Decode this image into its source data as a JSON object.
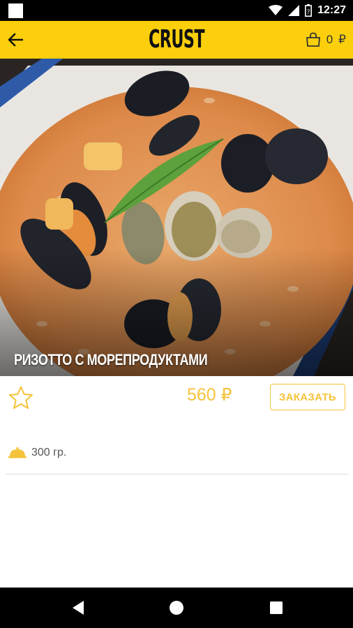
{
  "status_bar": {
    "time": "12:27"
  },
  "app_bar": {
    "logo": "CRUST",
    "cart_count": "0",
    "cart_currency": "₽"
  },
  "dish": {
    "title": "РИЗОТТО С МОРЕПРОДУКТАМИ",
    "price": "560 ₽",
    "order_label": "ЗАКАЗАТЬ",
    "weight": "300 гр."
  },
  "colors": {
    "brand_yellow": "#fbcf0b",
    "accent": "#f5c33a"
  },
  "icons": {
    "back": "arrow-left-icon",
    "cart": "shopping-bag-icon",
    "favorite": "star-outline-icon",
    "weight": "dish-cloche-icon"
  }
}
